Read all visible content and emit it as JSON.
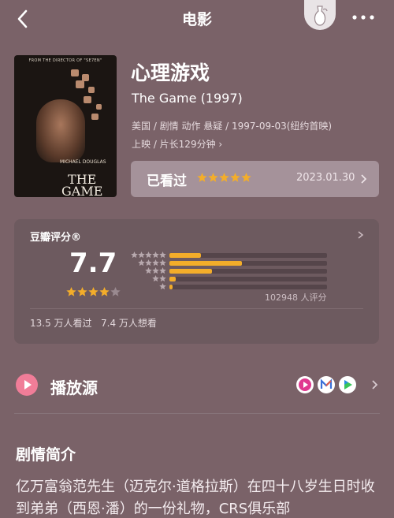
{
  "header": {
    "title": "电影",
    "back_icon": "back-arrow-icon",
    "more_icon": "more-dots-icon",
    "vase_icon": "vase-icon"
  },
  "poster": {
    "tagline": "FROM THE DIRECTOR OF \"SE7EN\"",
    "title_line1": "THE",
    "title_line2": "GAME",
    "actor": "MICHAEL DOUGLAS"
  },
  "movie": {
    "title": "心理游戏",
    "original_title": "The Game (1997)",
    "info_line1": "美国 / 剧情 动作 悬疑 / 1997-09-03(纽约首映)",
    "info_line2": "上映 / 片长129分钟",
    "chevron": "›"
  },
  "watched": {
    "label": "已看过",
    "stars": 5,
    "date": "2023.01.30",
    "star_color": "#f3ad2a"
  },
  "rating": {
    "title": "豆瓣评分®",
    "score": "7.7",
    "stars": 4,
    "distribution": [
      {
        "stars": 5,
        "fraction": 0.2
      },
      {
        "stars": 4,
        "fraction": 0.46
      },
      {
        "stars": 3,
        "fraction": 0.27
      },
      {
        "stars": 2,
        "fraction": 0.04
      },
      {
        "stars": 1,
        "fraction": 0.02
      }
    ],
    "count_text": "102948 人评分",
    "watched_text": "13.5 万人看过",
    "want_text": "7.4 万人想看",
    "bar_color": "#f3ad2a"
  },
  "play": {
    "label": "播放源",
    "icon": "play-circle-icon",
    "sources": [
      "youku-icon",
      "mgtv-icon",
      "iqiyi-icon"
    ]
  },
  "synopsis": {
    "title": "剧情简介",
    "text": "亿万富翁范先生（迈克尔·道格拉斯）在四十八岁生日时收到弟弟（西恩·潘）的一份礼物，CRS俱乐部"
  }
}
